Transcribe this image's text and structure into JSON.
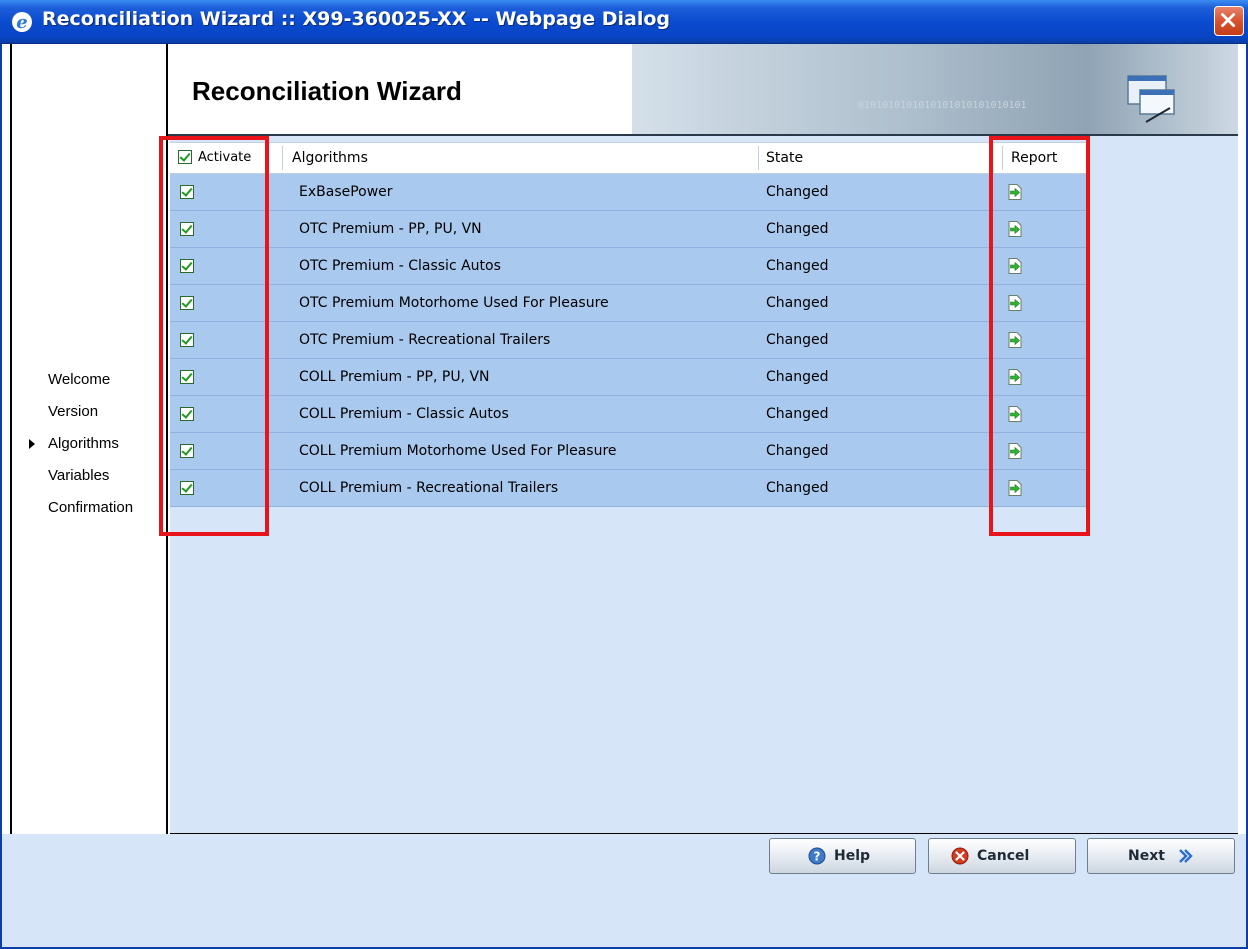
{
  "window": {
    "title": "Reconciliation Wizard :: X99-360025-XX -- Webpage Dialog"
  },
  "header": {
    "title": "Reconciliation Wizard",
    "banner_bits": "0101010101010101010101010101"
  },
  "nav": {
    "items": [
      {
        "label": "Welcome",
        "current": false
      },
      {
        "label": "Version",
        "current": false
      },
      {
        "label": "Algorithms",
        "current": true
      },
      {
        "label": "Variables",
        "current": false
      },
      {
        "label": "Confirmation",
        "current": false
      }
    ]
  },
  "table": {
    "columns": {
      "activate": "Activate",
      "algorithms": "Algorithms",
      "state": "State",
      "report": "Report"
    },
    "header_activate_checked": true,
    "rows": [
      {
        "checked": true,
        "algorithm": "ExBasePower",
        "state": "Changed"
      },
      {
        "checked": true,
        "algorithm": "OTC Premium - PP, PU, VN",
        "state": "Changed"
      },
      {
        "checked": true,
        "algorithm": "OTC Premium - Classic Autos",
        "state": "Changed"
      },
      {
        "checked": true,
        "algorithm": "OTC Premium Motorhome Used For Pleasure",
        "state": "Changed"
      },
      {
        "checked": true,
        "algorithm": "OTC Premium - Recreational Trailers",
        "state": "Changed"
      },
      {
        "checked": true,
        "algorithm": "COLL Premium - PP, PU, VN",
        "state": "Changed"
      },
      {
        "checked": true,
        "algorithm": "COLL Premium - Classic Autos",
        "state": "Changed"
      },
      {
        "checked": true,
        "algorithm": "COLL Premium Motorhome Used For Pleasure",
        "state": "Changed"
      },
      {
        "checked": true,
        "algorithm": "COLL Premium - Recreational Trailers",
        "state": "Changed"
      }
    ]
  },
  "buttons": {
    "help": "Help",
    "cancel": "Cancel",
    "next": "Next"
  },
  "colors": {
    "highlight": "#e8141a",
    "row_bg": "#a9c9ee",
    "panel_bg": "#d6e6f8",
    "titlebar": "#0a4bd0"
  },
  "icons": {
    "window": "ie-icon",
    "close": "close-icon",
    "nav_current": "triangle-right-icon",
    "report": "report-export-icon",
    "help": "help-icon",
    "cancel": "cancel-icon",
    "next": "chevron-right-icon"
  }
}
